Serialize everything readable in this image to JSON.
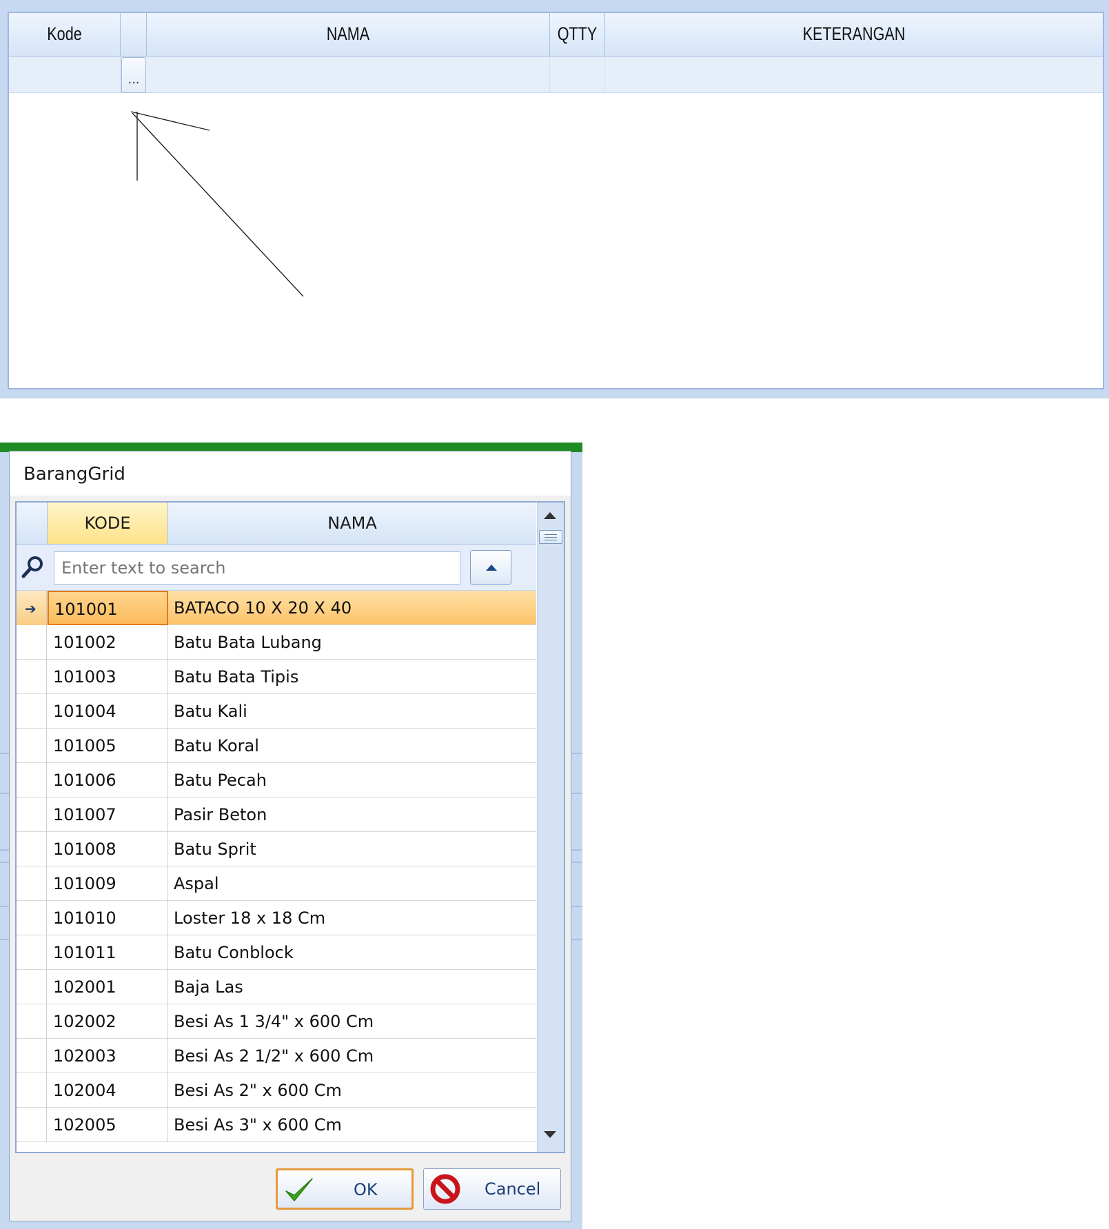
{
  "top_grid": {
    "columns": [
      "Kode",
      "",
      "NAMA",
      "QTTY",
      "KETERANGAN"
    ],
    "ellipsis_label": "..."
  },
  "dialog": {
    "title": "BarangGrid",
    "grid": {
      "columns": [
        "KODE",
        "NAMA"
      ],
      "search_placeholder": "Enter text to search",
      "rows": [
        {
          "kode": "101001",
          "nama": "BATACO 10 X 20 X 40",
          "selected": true
        },
        {
          "kode": "101002",
          "nama": "Batu Bata Lubang"
        },
        {
          "kode": "101003",
          "nama": "Batu Bata Tipis"
        },
        {
          "kode": "101004",
          "nama": "Batu Kali"
        },
        {
          "kode": "101005",
          "nama": "Batu Koral"
        },
        {
          "kode": "101006",
          "nama": "Batu Pecah"
        },
        {
          "kode": "101007",
          "nama": "Pasir Beton"
        },
        {
          "kode": "101008",
          "nama": "Batu Sprit"
        },
        {
          "kode": "101009",
          "nama": "Aspal"
        },
        {
          "kode": "101010",
          "nama": "Loster 18 x 18 Cm"
        },
        {
          "kode": "101011",
          "nama": "Batu Conblock"
        },
        {
          "kode": "102001",
          "nama": "Baja Las"
        },
        {
          "kode": "102002",
          "nama": "Besi As 1 3/4\" x 600 Cm"
        },
        {
          "kode": "102003",
          "nama": "Besi As 2 1/2\" x 600 Cm"
        },
        {
          "kode": "102004",
          "nama": "Besi As 2\" x 600 Cm"
        },
        {
          "kode": "102005",
          "nama": "Besi As 3\" x 600 Cm"
        }
      ]
    },
    "ok_label": "OK",
    "cancel_label": "Cancel"
  },
  "colors": {
    "accent_frame": "#c7d9f1",
    "dialog_title_strip": "#1f8b24",
    "selected_row": "#fdc36a",
    "focus_border": "#e4791a"
  },
  "icons": [
    "ellipsis",
    "arrow-annotation",
    "search-icon",
    "collapse-up-icon",
    "row-indicator-arrow-icon",
    "checkmark-icon",
    "cancel-icon"
  ]
}
